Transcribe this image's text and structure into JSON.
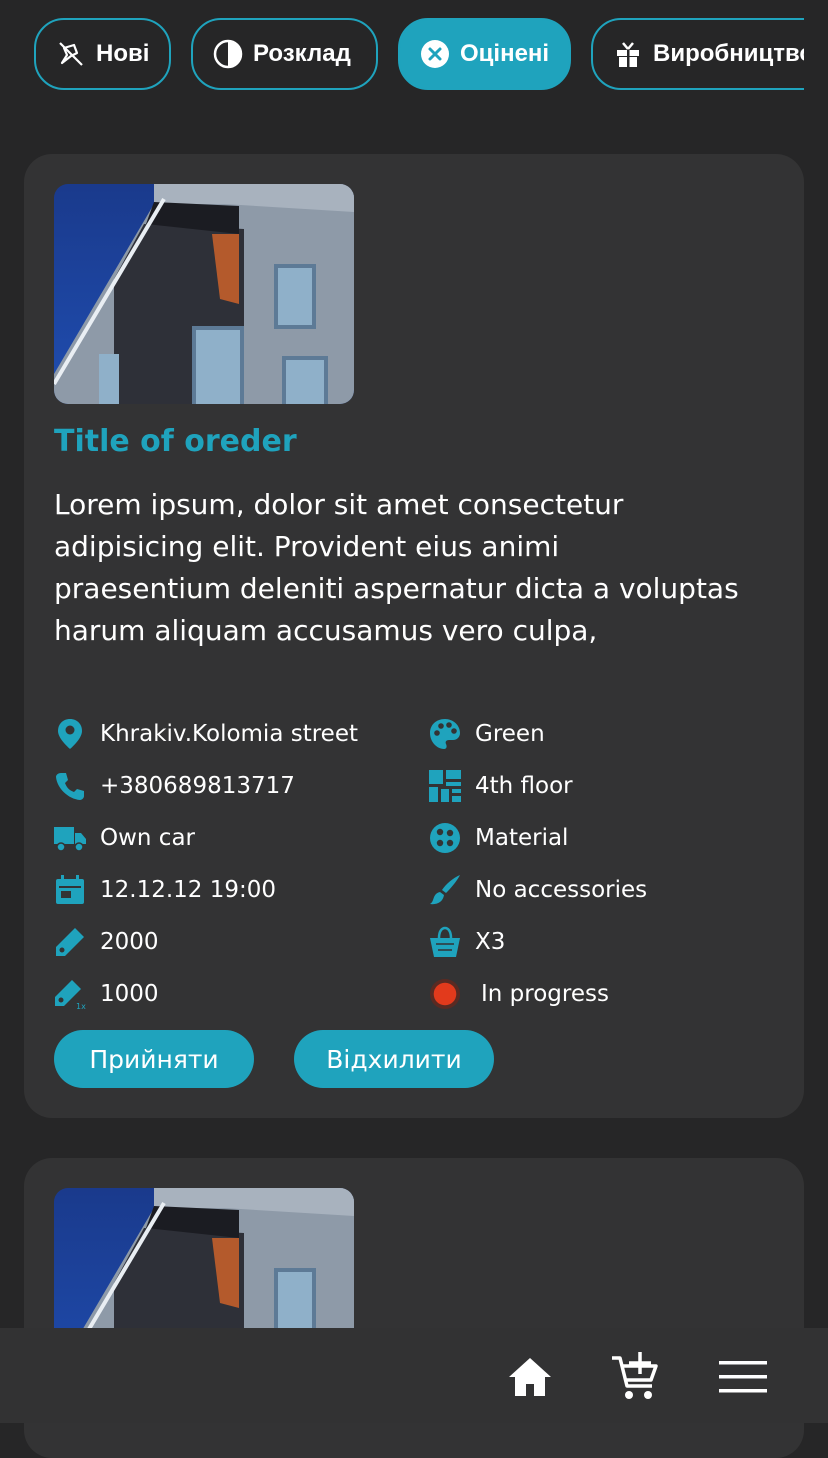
{
  "filters": [
    {
      "label": "Нові",
      "icon": "pin-off-icon",
      "active": false
    },
    {
      "label": "Розклад",
      "icon": "pie-chart-icon",
      "active": false
    },
    {
      "label": "Оцінені",
      "icon": "close-circle-icon",
      "active": true
    },
    {
      "label": "Виробництво",
      "icon": "gift-icon",
      "active": false
    }
  ],
  "orders": [
    {
      "title": "Title of oreder",
      "description": "Lorem ipsum, dolor sit amet consectetur adipisicing elit. Provident eius animi praesentium deleniti aspernatur dicta a voluptas harum aliquam accusamus vero culpa,",
      "details_left": [
        {
          "icon": "location-pin-icon",
          "text": "Khrakiv.Kolomia street"
        },
        {
          "icon": "phone-icon",
          "text": "+380689813717"
        },
        {
          "icon": "truck-icon",
          "text": "Own car"
        },
        {
          "icon": "calendar-icon",
          "text": "12.12.12 19:00"
        },
        {
          "icon": "price-tag-icon",
          "text": "2000"
        },
        {
          "icon": "price-tag-1x-icon",
          "text": "1000"
        }
      ],
      "details_right": [
        {
          "icon": "palette-icon",
          "text": "Green"
        },
        {
          "icon": "floor-plan-icon",
          "text": "4th floor"
        },
        {
          "icon": "material-icon",
          "text": "Material"
        },
        {
          "icon": "brush-icon",
          "text": "No accessories"
        },
        {
          "icon": "shopping-bag-icon",
          "text": "X3"
        },
        {
          "icon": "status-dot-icon",
          "text": "In progress"
        }
      ],
      "accept_label": "Прийняти",
      "decline_label": "Відхилити"
    }
  ],
  "colors": {
    "accent": "#1fa3bd",
    "background": "#262627",
    "card": "#333334",
    "status": "#e23a1c"
  },
  "bottom_nav": [
    {
      "icon": "home-icon"
    },
    {
      "icon": "cart-add-icon"
    },
    {
      "icon": "menu-icon"
    }
  ]
}
